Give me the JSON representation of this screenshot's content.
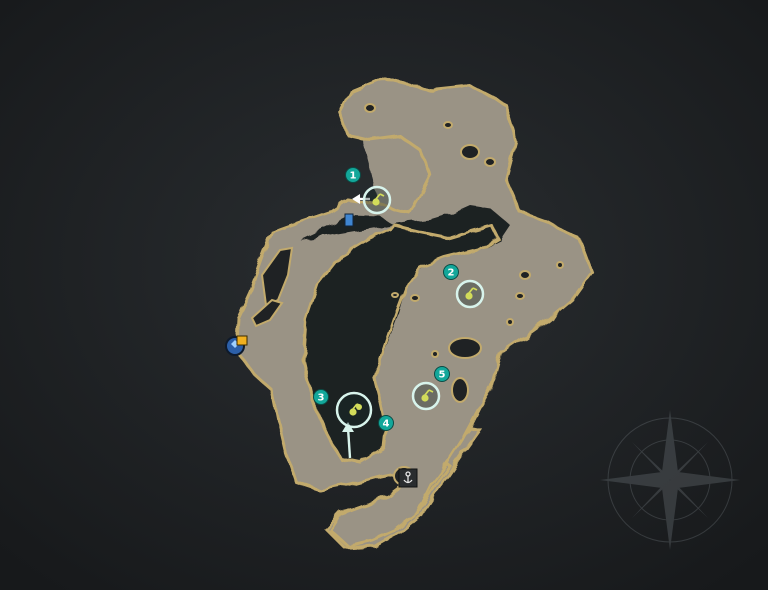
{
  "map": {
    "region": "island-map",
    "colors": {
      "background": "#1f2224",
      "land": "#9a9385",
      "coast": "#c2aa6c",
      "marker_ring": "#d8f4ec",
      "badge": "#13a79a",
      "resource": "#d2dc5a"
    },
    "markers": [
      {
        "label": "1",
        "icon": "resource-node-icon",
        "ring": true
      },
      {
        "label": "2",
        "icon": "resource-node-icon",
        "ring": true
      },
      {
        "label": "3",
        "icon": "resource-node-icon",
        "ring": true
      },
      {
        "label": "4",
        "icon": "resource-node-icon",
        "ring": false
      },
      {
        "label": "5",
        "icon": "resource-node-icon",
        "ring": true
      }
    ],
    "pois": [
      {
        "icon": "portal-waypoint-icon"
      },
      {
        "icon": "dock-anchor-icon"
      },
      {
        "icon": "door-entrance-icon"
      }
    ],
    "decorations": [
      {
        "icon": "compass-rose-icon"
      }
    ]
  }
}
